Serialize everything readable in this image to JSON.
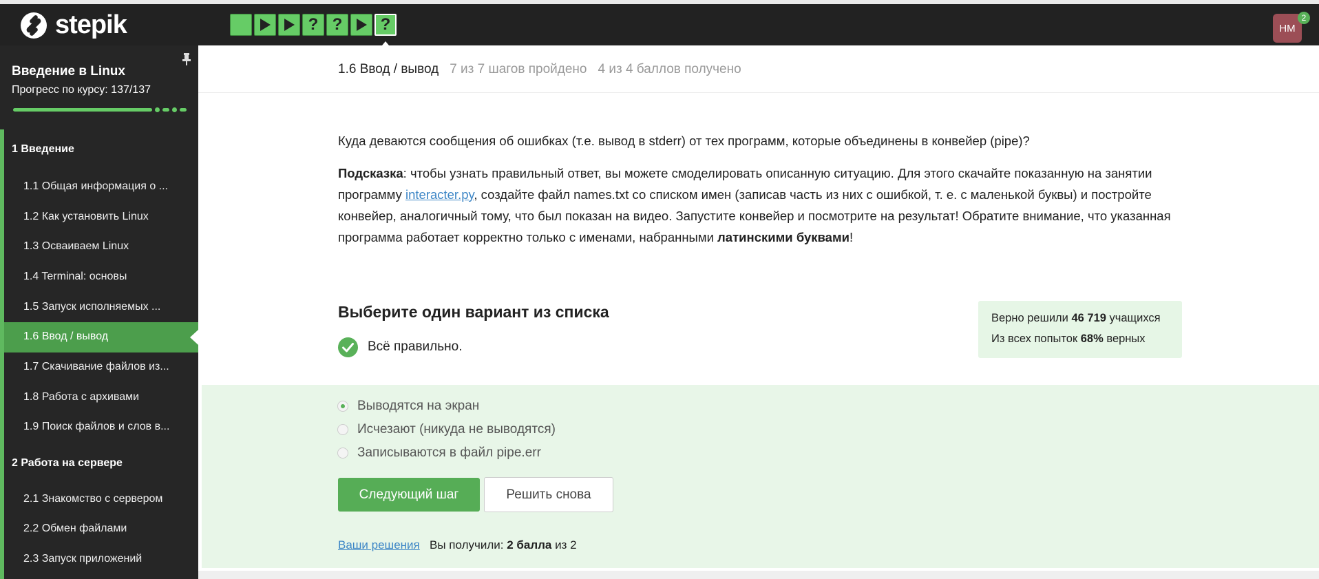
{
  "brand": {
    "name": "stepik"
  },
  "steps": [
    {
      "icon": "square-icon",
      "glyph": ""
    },
    {
      "icon": "play-icon",
      "glyph": ""
    },
    {
      "icon": "play-icon",
      "glyph": ""
    },
    {
      "icon": "question-icon",
      "glyph": "?"
    },
    {
      "icon": "question-icon",
      "glyph": "?"
    },
    {
      "icon": "play-icon",
      "glyph": ""
    },
    {
      "icon": "question-icon",
      "glyph": "?"
    }
  ],
  "user": {
    "initials": "HM",
    "notifications": "2"
  },
  "sidebar": {
    "course_title": "Введение в Linux",
    "progress_text": "Прогресс по курсу:  137/137",
    "progress_fraction": 1.0,
    "modules": [
      {
        "label": "1  Введение",
        "lessons": [
          "1.1  Общая информация о ...",
          "1.2  Как установить Linux",
          "1.3  Осваиваем Linux",
          "1.4  Terminal: основы",
          "1.5  Запуск исполняемых ...",
          "1.6  Ввод / вывод",
          "1.7  Скачивание файлов из...",
          "1.8  Работа с архивами",
          "1.9  Поиск файлов и слов в..."
        ]
      },
      {
        "label": "2  Работа на сервере",
        "lessons": [
          "2.1  Знакомство с сервером",
          "2.2  Обмен файлами",
          "2.3  Запуск приложений"
        ]
      }
    ]
  },
  "lesson": {
    "title": "1.6 Ввод / вывод",
    "steps_done": "7 из 7 шагов пройдено",
    "score_meta": "4 из 4 баллов  получено"
  },
  "question": {
    "text": "Куда деваются сообщения об ошибках (т.е. вывод в stderr) от тех программ, которые объединены в конвейер (pipe)?",
    "hint_bold": "Подсказка",
    "hint_1": ": чтобы узнать правильный ответ, вы можете смоделировать описанную ситуацию. Для этого скачайте показанную на занятии программу ",
    "hint_link": "interacter.py",
    "hint_2": ", создайте файл names.txt со списком имен (записав часть из них с ошибкой, т. е. с маленькой буквы) и постройте конвейер, аналогичный тому, что был показан на видео. Запустите конвейер и посмотрите на результат! Обратите внимание, что указанная программа работает корректно только с именами, набранными ",
    "hint_bold2": "латинскими буквами",
    "hint_3": "!"
  },
  "quiz": {
    "title": "Выберите один вариант из списка",
    "status": "Всё правильно.",
    "options": [
      {
        "label": "Выводятся на экран",
        "selected": true
      },
      {
        "label": "Исчезают (никуда не выводятся)",
        "selected": false
      },
      {
        "label": "Записываются в файл pipe.err",
        "selected": false
      }
    ],
    "next_label": "Следующий шаг",
    "retry_label": "Решить снова",
    "solutions_link": "Ваши решения",
    "score_prefix": "Вы получили: ",
    "score_value": "2 балла",
    "score_suffix": " из 2"
  },
  "stats": {
    "line1_prefix": "Верно решили ",
    "line1_value": "46 719",
    "line1_suffix": " учащихся",
    "line2_prefix": "Из всех попыток ",
    "line2_value": "68%",
    "line2_suffix": " верных"
  },
  "colors": {
    "accent": "#66cc66",
    "sidebar": "#262626",
    "active_lesson": "#4c9e4c",
    "link": "#3d86c6",
    "panel": "#e8f6e8"
  }
}
